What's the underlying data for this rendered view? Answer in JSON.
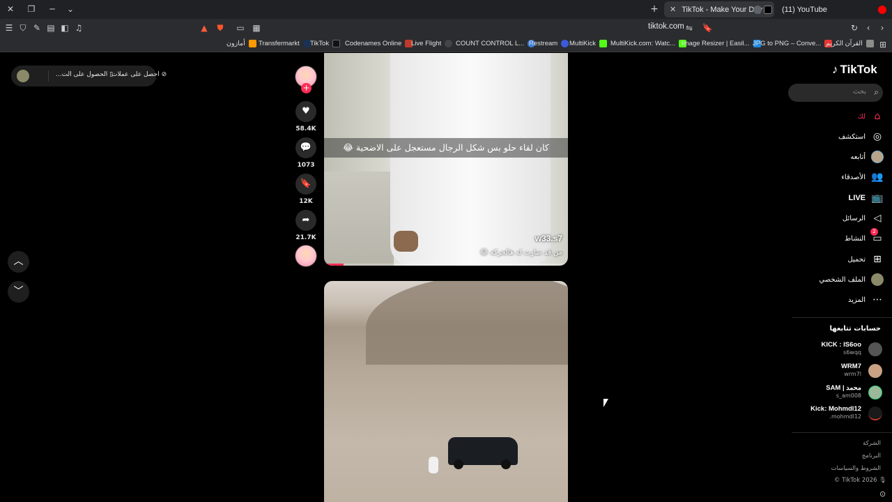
{
  "browser": {
    "tabs": [
      {
        "title": "TikTok - Make Your Day",
        "active": true
      },
      {
        "title": "(11) YouTube",
        "active": false
      }
    ],
    "url": "tiktok.com",
    "bookmarks": [
      {
        "label": "أمازون",
        "color": "#ff9900"
      },
      {
        "label": "Transfermarkt",
        "color": "#1a3151"
      },
      {
        "label": "TikTok",
        "color": "#111111"
      },
      {
        "label": "Codenames Online",
        "color": "#c0392b"
      },
      {
        "label": "Live Flight",
        "color": "#444444"
      },
      {
        "label": "COUNT CONTROL L...",
        "color": "#3a7bd5"
      },
      {
        "label": "Restream",
        "color": "#3b5bdb"
      },
      {
        "label": "MultiKick",
        "color": "#53fc18"
      },
      {
        "label": "MultiKick.com: Watc...",
        "color": "#53fc18"
      },
      {
        "label": "Image Resizer | Easil...",
        "color": "#1e88e5"
      },
      {
        "label": "JPG to PNG – Conve...",
        "color": "#e53935"
      },
      {
        "label": "القرآن الكريم",
        "color": "#8d8d8d"
      }
    ]
  },
  "coins": {
    "get_coins": "احصل على عملات",
    "get_app": "الحصول على الت..."
  },
  "video1": {
    "caption": "كان لقاء حلو بس شكل الرجال مستعجل على الاضحية 😂",
    "watermark": "w33.s7",
    "subcaption": "من قد صارت له هالحركة 😂",
    "progress": 0.08
  },
  "actions": {
    "likes": "58.4K",
    "comments": "1073",
    "saves": "12K",
    "shares": "21.7K"
  },
  "sidebar": {
    "logo": "TikTok",
    "search_placeholder": "بحث",
    "menu": [
      {
        "label": "لك",
        "icon": "home-icon"
      },
      {
        "label": "استكشف",
        "icon": "compass-icon"
      },
      {
        "label": "أتابعه",
        "icon": "avatar-icon"
      },
      {
        "label": "الأصدقاء",
        "icon": "friends-icon"
      },
      {
        "label": "LIVE",
        "icon": "live-icon"
      },
      {
        "label": "الرسائل",
        "icon": "send-icon"
      },
      {
        "label": "النشاط",
        "icon": "inbox-icon",
        "badge": "2"
      },
      {
        "label": "تحميل",
        "icon": "upload-icon"
      },
      {
        "label": "الملف الشخصي",
        "icon": "profile-avatar-icon"
      },
      {
        "label": "المزيد",
        "icon": "more-icon"
      }
    ],
    "following_title": "حسابات تتابعها",
    "following": [
      {
        "name": "KICK : IS6oo",
        "handle": "s6wqq"
      },
      {
        "name": "WRM7",
        "handle": "wrm7l"
      },
      {
        "name": "SAM | محمد",
        "handle": "s_am008"
      },
      {
        "name": "Kick: Mohmdl12",
        "handle": ".mohmdl12"
      }
    ],
    "footer": {
      "company": "الشركة",
      "program": "البرنامج",
      "terms": "الشروط والسياسات",
      "copyright": "© TikTok 2026"
    }
  },
  "colors": {
    "accent": "#fe2c55"
  }
}
